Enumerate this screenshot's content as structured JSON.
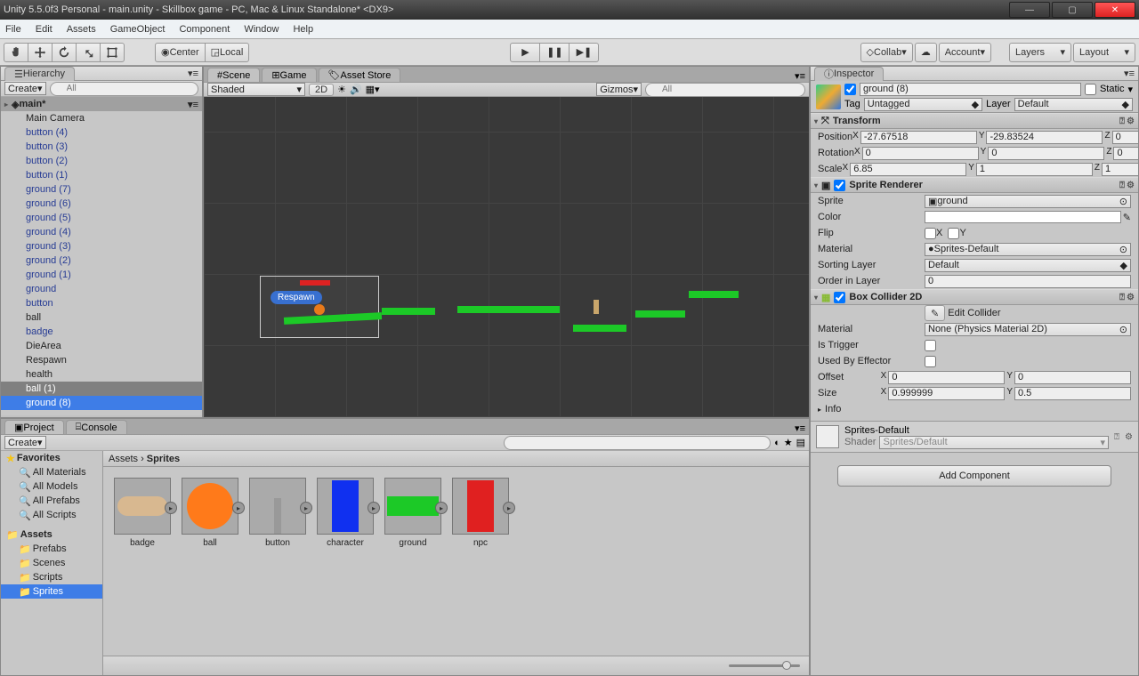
{
  "window_title": "Unity 5.5.0f3 Personal - main.unity - Skillbox game - PC, Mac & Linux Standalone* <DX9>",
  "menubar": [
    "File",
    "Edit",
    "Assets",
    "GameObject",
    "Component",
    "Window",
    "Help"
  ],
  "toolbar": {
    "center": "Center",
    "local": "Local",
    "collab": "Collab",
    "account": "Account",
    "layers": "Layers",
    "layout": "Layout"
  },
  "hierarchy": {
    "title": "Hierarchy",
    "create": "Create",
    "scene": "main*",
    "items": [
      {
        "n": "Main Camera",
        "c": "black"
      },
      {
        "n": "button (4)",
        "c": "blue"
      },
      {
        "n": "button (3)",
        "c": "blue"
      },
      {
        "n": "button (2)",
        "c": "blue"
      },
      {
        "n": "button (1)",
        "c": "blue"
      },
      {
        "n": "ground (7)",
        "c": "blue"
      },
      {
        "n": "ground (6)",
        "c": "blue"
      },
      {
        "n": "ground (5)",
        "c": "blue"
      },
      {
        "n": "ground (4)",
        "c": "blue"
      },
      {
        "n": "ground (3)",
        "c": "blue"
      },
      {
        "n": "ground (2)",
        "c": "blue"
      },
      {
        "n": "ground (1)",
        "c": "blue"
      },
      {
        "n": "ground",
        "c": "blue"
      },
      {
        "n": "button",
        "c": "blue"
      },
      {
        "n": "ball",
        "c": "black"
      },
      {
        "n": "badge",
        "c": "blue"
      },
      {
        "n": "DieArea",
        "c": "black"
      },
      {
        "n": "Respawn",
        "c": "black"
      },
      {
        "n": "health",
        "c": "black"
      },
      {
        "n": "ball (1)",
        "c": "black",
        "sel": "gray"
      },
      {
        "n": "ground (8)",
        "c": "blue",
        "sel": "blue"
      }
    ]
  },
  "scene_tabs": [
    "Scene",
    "Game",
    "Asset Store"
  ],
  "scene_sub": {
    "shaded": "Shaded",
    "2d": "2D",
    "gizmos": "Gizmos"
  },
  "scene_badge": "Respawn",
  "project": {
    "tabs": [
      "Project",
      "Console"
    ],
    "create": "Create",
    "favorites": "Favorites",
    "fav": [
      "All Materials",
      "All Models",
      "All Prefabs",
      "All Scripts"
    ],
    "assets_label": "Assets",
    "folders": [
      "Prefabs",
      "Scenes",
      "Scripts",
      "Sprites"
    ],
    "breadcrumb": [
      "Assets",
      "Sprites"
    ],
    "tiles": [
      "badge",
      "ball",
      "button",
      "character",
      "ground",
      "npc"
    ]
  },
  "inspector": {
    "title": "Inspector",
    "obj_name": "ground (8)",
    "static": "Static",
    "tag_label": "Tag",
    "tag": "Untagged",
    "layer_label": "Layer",
    "layer": "Default",
    "transform": {
      "title": "Transform",
      "pos": {
        "x": "-27.67518",
        "y": "-29.83524",
        "z": "0"
      },
      "rot": {
        "x": "0",
        "y": "0",
        "z": "0"
      },
      "scale": {
        "x": "6.85",
        "y": "1",
        "z": "1"
      },
      "pos_label": "Position",
      "rot_label": "Rotation",
      "scale_label": "Scale"
    },
    "sr": {
      "title": "Sprite Renderer",
      "sprite": "ground",
      "color": "#FFFFFF",
      "flip": "Flip",
      "flipx": "X",
      "flipy": "Y",
      "material": "Sprites-Default",
      "sorting": "Default",
      "order": "0",
      "sprite_label": "Sprite",
      "color_label": "Color",
      "mat_label": "Material",
      "sort_label": "Sorting Layer",
      "ord_label": "Order in Layer"
    },
    "bc": {
      "title": "Box Collider 2D",
      "edit": "Edit Collider",
      "mat": "None (Physics Material 2D)",
      "trigger": "Is Trigger",
      "eff": "Used By Effector",
      "offset": {
        "x": "0",
        "y": "0"
      },
      "size": {
        "x": "0.999999",
        "y": "0.5"
      },
      "info": "Info",
      "mat_label": "Material",
      "off_label": "Offset",
      "size_label": "Size"
    },
    "mat": {
      "name": "Sprites-Default",
      "shader_label": "Shader",
      "shader": "Sprites/Default"
    },
    "addcomp": "Add Component"
  }
}
